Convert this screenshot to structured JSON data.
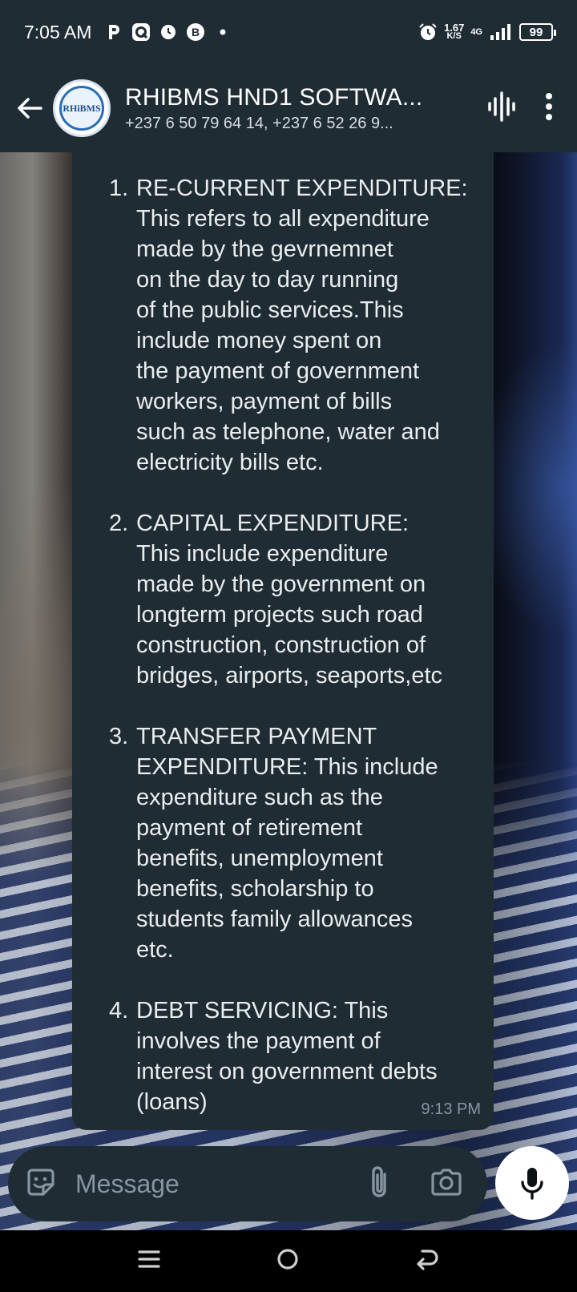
{
  "status_bar": {
    "time": "7:05 AM",
    "net_speed_value": "1.67",
    "net_speed_unit": "K/S",
    "network_type": "4G",
    "battery": "99",
    "left_icons": [
      "p-icon",
      "q-app-icon",
      "clock-icon",
      "bitcoin-icon",
      "dot-icon"
    ]
  },
  "header": {
    "title": "RHIBMS HND1 SOFTWA...",
    "subtitle": "+237 6 50 79 64 14, +237 6 52 26 9...",
    "avatar_text": "RHiBMS"
  },
  "message": {
    "items": [
      {
        "num": "1.",
        "text": "RE-CURRENT EXPENDITURE:\nThis refers to all expenditure\nmade by the gevrnemnet\non the day to day running\nof the public services.This\ninclude money spent on\nthe payment of government\nworkers, payment of bills\nsuch as telephone, water and\nelectricity bills etc."
      },
      {
        "num": "2.",
        "text": "CAPITAL EXPENDITURE:\nThis include expenditure\nmade by the government on\nlongterm projects such road\nconstruction, construction of\nbridges, airports, seaports,etc"
      },
      {
        "num": "3.",
        "text": "TRANSFER PAYMENT\nEXPENDITURE: This include\nexpenditure such as the\npayment of retirement\nbenefits, unemployment\nbenefits, scholarship to\nstudents family allowances\netc."
      },
      {
        "num": "4.",
        "text": "DEBT SERVICING: This\ninvolves the payment of\ninterest on government debts\n(loans)"
      }
    ],
    "time": "9:13 PM"
  },
  "input": {
    "placeholder": "Message"
  },
  "colors": {
    "bar_bg": "#1f2c34",
    "bubble_bg": "#202c33",
    "text": "#e9edef",
    "muted": "#8696a0"
  }
}
